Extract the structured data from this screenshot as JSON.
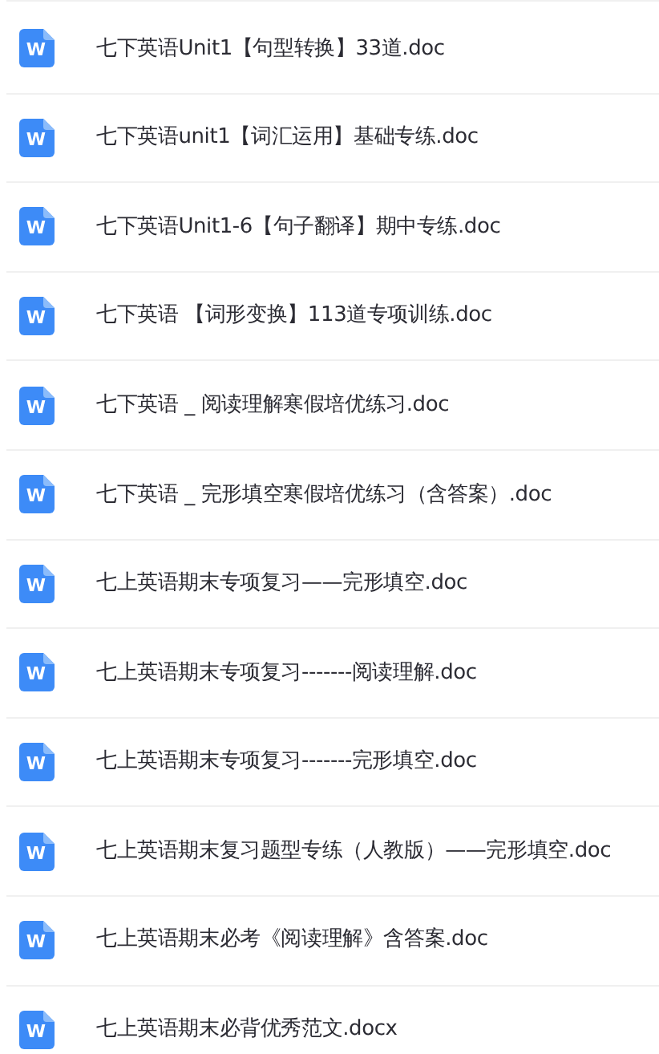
{
  "files": [
    {
      "icon_letter": "W",
      "name": "七下英语Unit1【句型转换】33道.doc"
    },
    {
      "icon_letter": "W",
      "name": "七下英语unit1【词汇运用】基础专练.doc"
    },
    {
      "icon_letter": "W",
      "name": "七下英语Unit1-6【句子翻译】期中专练.doc"
    },
    {
      "icon_letter": "W",
      "name": "七下英语 【词形变换】113道专项训练.doc"
    },
    {
      "icon_letter": "W",
      "name": "七下英语 _ 阅读理解寒假培优练习.doc"
    },
    {
      "icon_letter": "W",
      "name": "七下英语 _ 完形填空寒假培优练习（含答案）.doc"
    },
    {
      "icon_letter": "W",
      "name": "七上英语期末专项复习——完形填空.doc"
    },
    {
      "icon_letter": "W",
      "name": "七上英语期末专项复习-------阅读理解.doc"
    },
    {
      "icon_letter": "W",
      "name": "七上英语期末专项复习-------完形填空.doc"
    },
    {
      "icon_letter": "W",
      "name": "七上英语期末复习题型专练（人教版）——完形填空.doc"
    },
    {
      "icon_letter": "W",
      "name": "七上英语期末必考《阅读理解》含答案.doc"
    },
    {
      "icon_letter": "W",
      "name": "七上英语期末必背优秀范文.docx"
    }
  ]
}
